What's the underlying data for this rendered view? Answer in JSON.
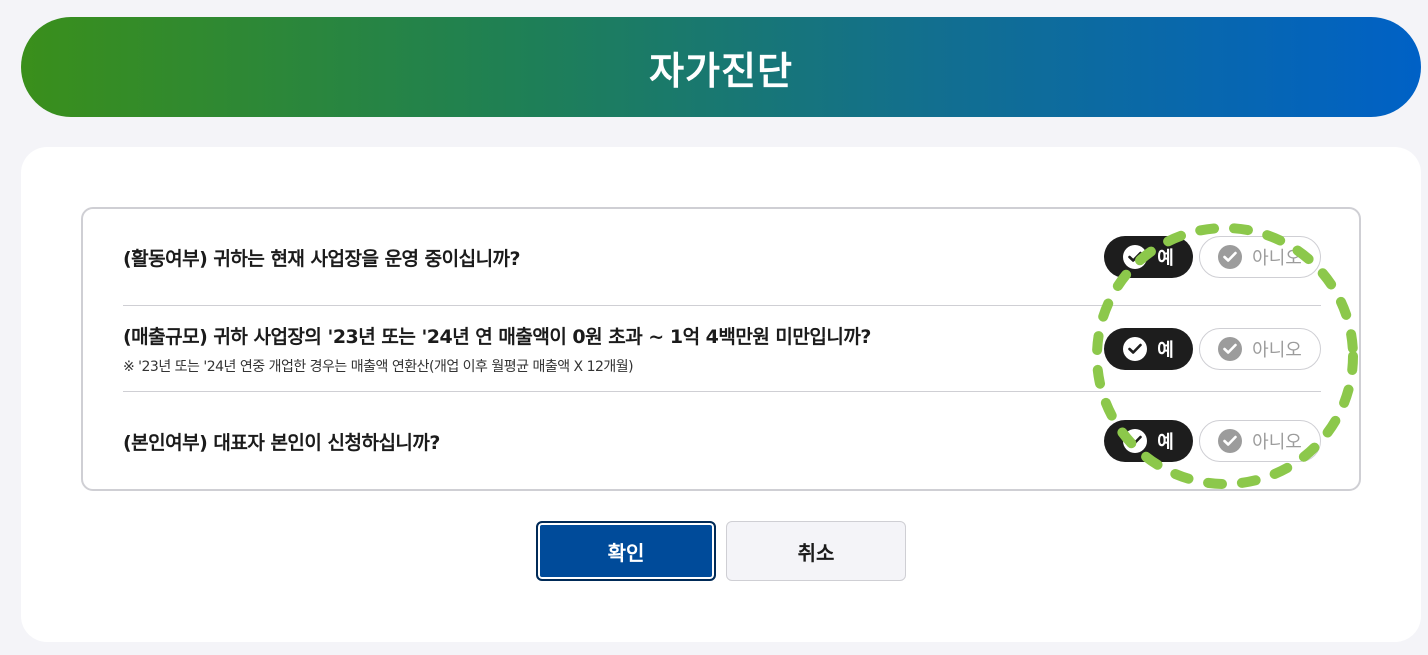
{
  "header": {
    "title": "자가진단"
  },
  "questions": [
    {
      "text": "(활동여부) 귀하는 현재 사업장을 운영 중이십니까?",
      "note": "",
      "yes_label": "예",
      "no_label": "아니오",
      "selected": "yes"
    },
    {
      "text": "(매출규모) 귀하 사업장의 '23년 또는 '24년 연 매출액이 0원 초과 ~ 1억 4백만원 미만입니까?",
      "note": "※ '23년 또는 '24년 연중 개업한 경우는 매출액 연환산(개업 이후 월평균 매출액 X 12개월)",
      "yes_label": "예",
      "no_label": "아니오",
      "selected": "yes"
    },
    {
      "text": "(본인여부) 대표자 본인이 신청하십니까?",
      "note": "",
      "yes_label": "예",
      "no_label": "아니오",
      "selected": "yes"
    }
  ],
  "actions": {
    "confirm_label": "확인",
    "cancel_label": "취소"
  },
  "colors": {
    "header_gradient_start": "#3a8f1b",
    "header_gradient_end": "#0061c6",
    "selected_button": "#1d1d1d",
    "confirm_button": "#004b9a",
    "highlight_ring": "#8cc84b"
  }
}
